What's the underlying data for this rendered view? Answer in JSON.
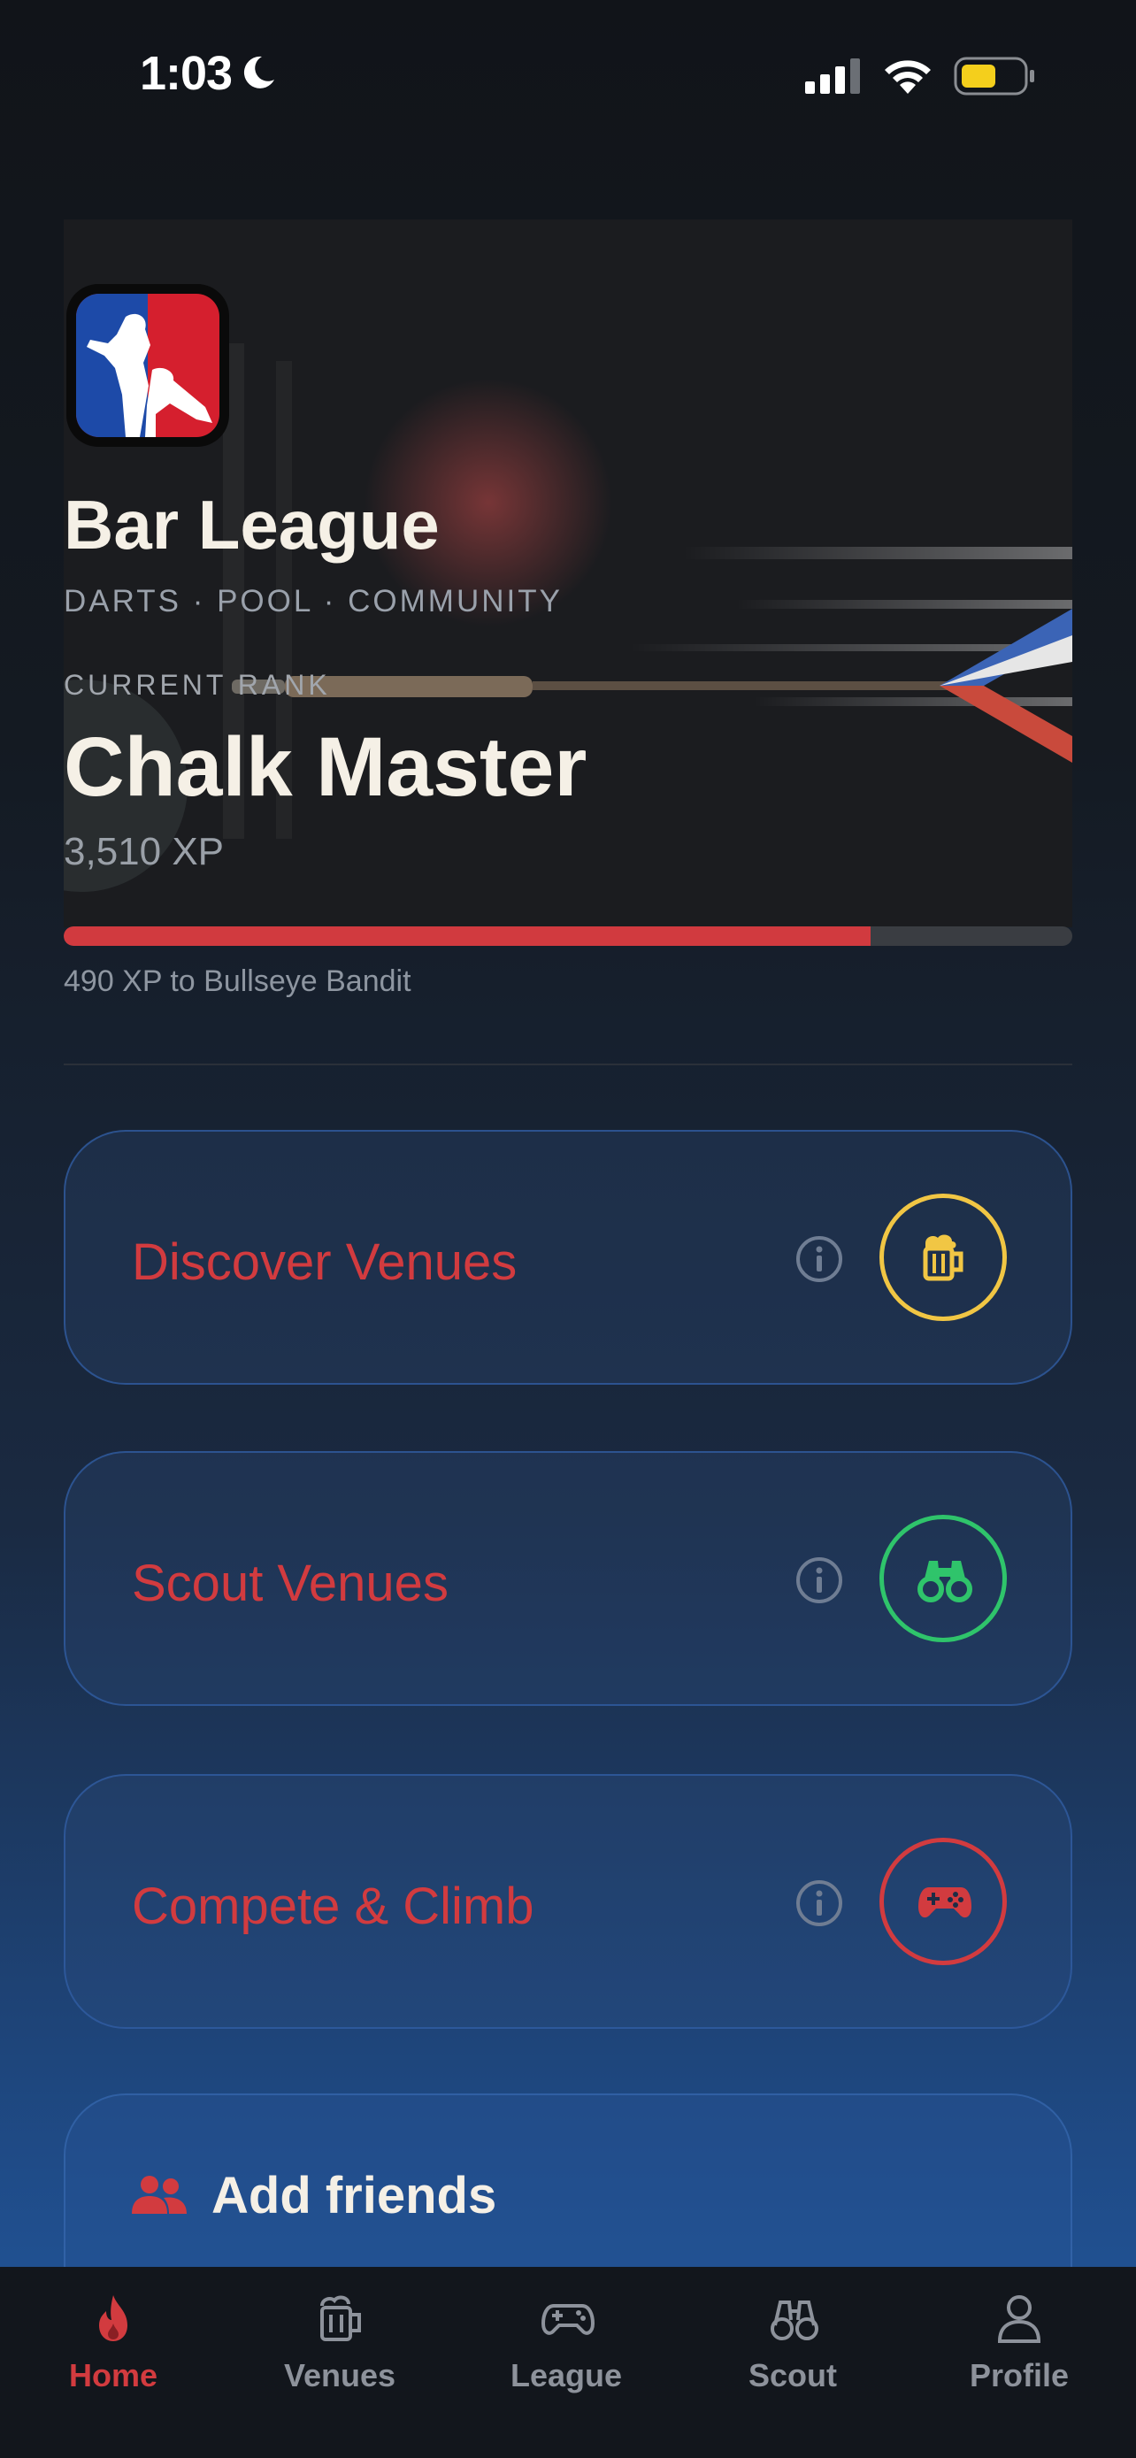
{
  "status_bar": {
    "time": "1:03"
  },
  "hero": {
    "app_name": "Bar League",
    "tagline": "DARTS · POOL · COMMUNITY",
    "rank_label": "CURRENT RANK",
    "rank_name": "Chalk Master",
    "xp": "3,510 XP",
    "progress_fraction": 0.8,
    "next_rank_text": "490 XP to Bullseye Bandit"
  },
  "cards": [
    {
      "title": "Discover Venues",
      "icon": "beer-mug-icon",
      "accent": "#f1c644"
    },
    {
      "title": "Scout Venues",
      "icon": "binoculars-icon",
      "accent": "#2fc46b"
    },
    {
      "title": "Compete & Climb",
      "icon": "gamepad-icon",
      "accent": "#d23b3f"
    }
  ],
  "friends": {
    "label": "Add friends",
    "icon": "users-icon"
  },
  "tabs": [
    {
      "label": "Home",
      "icon": "flame-icon",
      "active": true
    },
    {
      "label": "Venues",
      "icon": "beer-mug-icon",
      "active": false
    },
    {
      "label": "League",
      "icon": "gamepad-icon",
      "active": false
    },
    {
      "label": "Scout",
      "icon": "binoculars-icon",
      "active": false
    },
    {
      "label": "Profile",
      "icon": "person-icon",
      "active": false
    }
  ],
  "colors": {
    "accent_red": "#d23b3f",
    "gold": "#f1c644",
    "green": "#2fc46b"
  }
}
